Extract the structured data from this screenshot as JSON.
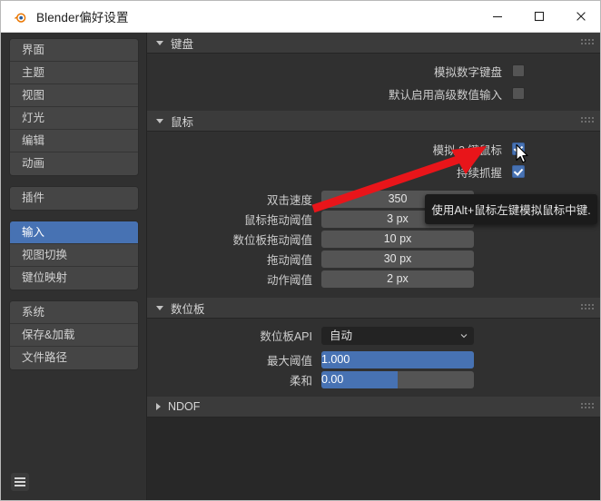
{
  "window": {
    "title": "Blender偏好设置",
    "logo_icon": "blender-logo-icon",
    "minimize_label": "minimize-icon",
    "maximize_label": "maximize-icon",
    "close_label": "close-icon"
  },
  "colors": {
    "accent_blue": "#4772b3",
    "panel_bg": "#303030",
    "content_bg": "#282828",
    "header_bg": "#3b3b3b",
    "field_bg": "#545454",
    "annotation_red": "#e8151a"
  },
  "sidebar": {
    "groups": [
      {
        "items": [
          {
            "label": "界面",
            "selected": false
          },
          {
            "label": "主题",
            "selected": false
          },
          {
            "label": "视图",
            "selected": false
          },
          {
            "label": "灯光",
            "selected": false
          },
          {
            "label": "编辑",
            "selected": false
          },
          {
            "label": "动画",
            "selected": false
          }
        ]
      },
      {
        "items": [
          {
            "label": "插件",
            "selected": false
          }
        ]
      },
      {
        "items": [
          {
            "label": "输入",
            "selected": true
          },
          {
            "label": "视图切换",
            "selected": false
          },
          {
            "label": "键位映射",
            "selected": false
          }
        ]
      },
      {
        "items": [
          {
            "label": "系统",
            "selected": false
          },
          {
            "label": "保存&加载",
            "selected": false
          },
          {
            "label": "文件路径",
            "selected": false
          }
        ]
      }
    ],
    "menu_icon": "hamburger-menu-icon"
  },
  "panels": {
    "keyboard": {
      "title": "键盘",
      "expanded": true,
      "grip_icon": "drag-grip-icon",
      "checkboxes": [
        {
          "label": "模拟数字键盘",
          "checked": false
        },
        {
          "label": "默认启用高级数值输入",
          "checked": false
        }
      ]
    },
    "mouse": {
      "title": "鼠标",
      "expanded": true,
      "grip_icon": "drag-grip-icon",
      "checkboxes": [
        {
          "label": "模拟 3 键鼠标",
          "checked": true
        },
        {
          "label": "持续抓握",
          "checked": true
        }
      ],
      "fields": [
        {
          "label": "双击速度",
          "value": "350"
        },
        {
          "label": "鼠标拖动阈值",
          "value": "3 px"
        },
        {
          "label": "数位板拖动阈值",
          "value": "10 px"
        },
        {
          "label": "拖动阈值",
          "value": "30 px"
        },
        {
          "label": "动作阈值",
          "value": "2 px"
        }
      ]
    },
    "tablet": {
      "title": "数位板",
      "expanded": true,
      "grip_icon": "drag-grip-icon",
      "api": {
        "label": "数位板API",
        "value": "自动",
        "chevron_icon": "chevron-down-icon"
      },
      "sliders": [
        {
          "label": "最大阈值",
          "value": "1.000",
          "fill_percent": 100
        },
        {
          "label": "柔和",
          "value": "0.00",
          "fill_percent": 50
        }
      ]
    },
    "ndof": {
      "title": "NDOF",
      "expanded": false,
      "grip_icon": "drag-grip-icon"
    }
  },
  "tooltip": {
    "text": "使用Alt+鼠标左键模拟鼠标中键."
  },
  "cursor": {
    "icon": "mouse-pointer-icon"
  },
  "annotation": {
    "icon": "red-arrow-annotation"
  }
}
